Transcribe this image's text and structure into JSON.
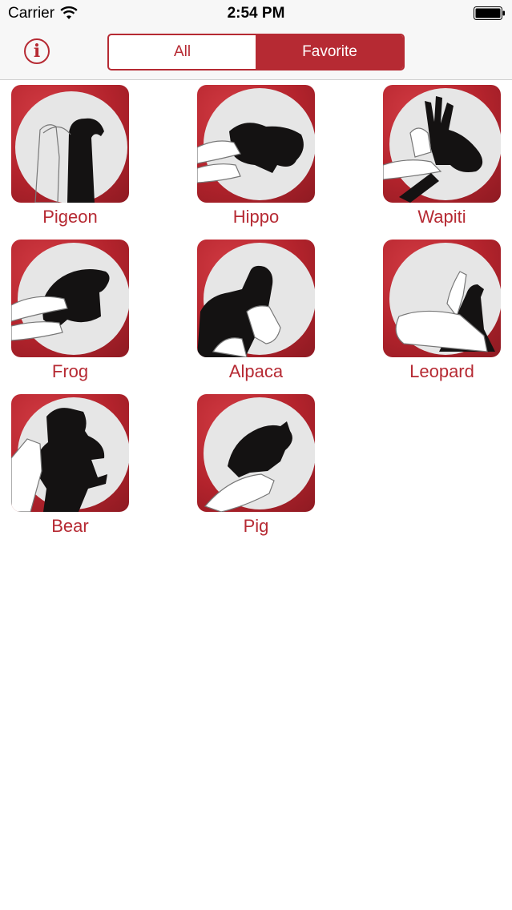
{
  "status_bar": {
    "carrier": "Carrier",
    "time": "2:54 PM",
    "wifi_icon": "wifi-icon",
    "battery_icon": "battery-icon"
  },
  "nav": {
    "info_icon": "info-icon",
    "info_glyph": "i",
    "segments": [
      {
        "label": "All",
        "selected": false
      },
      {
        "label": "Favorite",
        "selected": true
      }
    ]
  },
  "colors": {
    "accent": "#b62a33",
    "tile_red": "#b3232c",
    "disc": "#e6e6e6",
    "shadow": "#141212"
  },
  "animals": [
    {
      "label": "Pigeon"
    },
    {
      "label": "Hippo"
    },
    {
      "label": "Wapiti"
    },
    {
      "label": "Frog"
    },
    {
      "label": "Alpaca"
    },
    {
      "label": "Leopard"
    },
    {
      "label": "Bear"
    },
    {
      "label": "Pig"
    }
  ]
}
